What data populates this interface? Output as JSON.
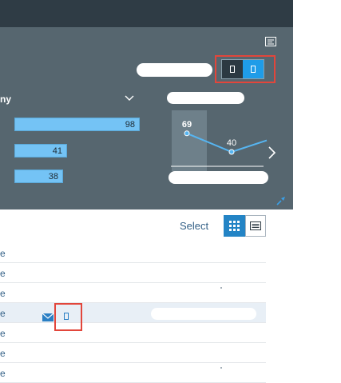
{
  "header": {
    "toggle_icon": "panel-collapse-icon"
  },
  "kpi_panel": {
    "dropdown_label": "ny",
    "bars": [
      {
        "value": 98,
        "fraction": 0.98
      },
      {
        "value": 41,
        "fraction": 0.41
      },
      {
        "value": 38,
        "fraction": 0.38
      }
    ],
    "micro_chart": {
      "points": [
        {
          "label": "69",
          "value": 69,
          "highlighted": true
        },
        {
          "label": "40",
          "value": 40
        },
        {
          "label": "",
          "value": 58
        }
      ]
    }
  },
  "table_toolbar": {
    "select_label": "Select",
    "grid_icon": "grid-view-icon",
    "list_icon": "list-view-icon"
  },
  "table": {
    "rows": [
      {
        "text": "e"
      },
      {
        "text": "e"
      },
      {
        "text": "e"
      },
      {
        "text": "e",
        "selected": true
      },
      {
        "text": "e"
      },
      {
        "text": "e"
      },
      {
        "text": "e"
      }
    ]
  },
  "colors": {
    "accent": "#1f9ce8",
    "bar": "#74c3f5",
    "highlight": "#e2463b",
    "panel": "#56666f",
    "topbar": "#2f3c45",
    "link": "#346187"
  }
}
